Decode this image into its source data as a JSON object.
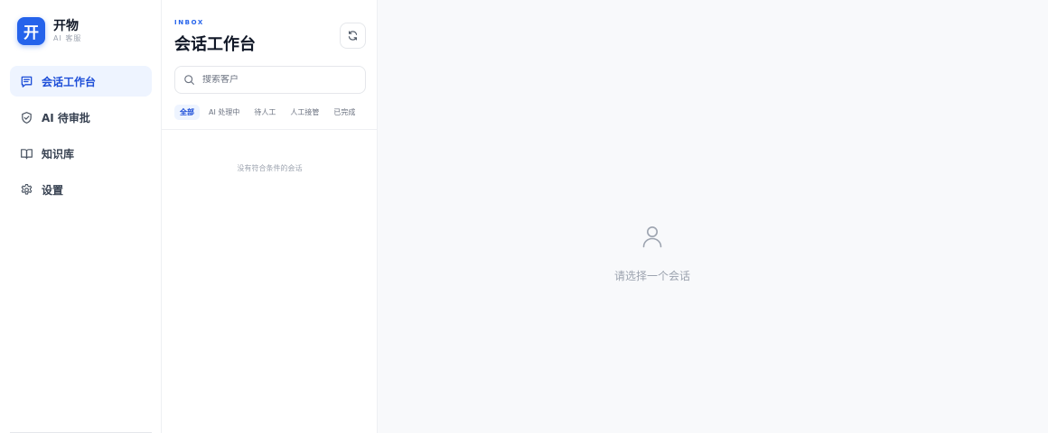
{
  "brand": {
    "logo_glyph": "开",
    "name": "开物",
    "subtitle": "AI 客服",
    "accent": "#2563eb"
  },
  "sidebar": {
    "items": [
      {
        "label": "会话工作台",
        "icon": "chat-lines-icon",
        "active": true
      },
      {
        "label": "AI 待审批",
        "icon": "shield-check-icon",
        "active": false
      },
      {
        "label": "知识库",
        "icon": "book-open-icon",
        "active": false
      },
      {
        "label": "设置",
        "icon": "gear-icon",
        "active": false
      }
    ]
  },
  "inbox": {
    "eyebrow": "INBOX",
    "title": "会话工作台",
    "refresh_icon": "refresh-icon",
    "search": {
      "placeholder": "搜索客户",
      "value": ""
    },
    "filters": [
      {
        "label": "全部",
        "active": true
      },
      {
        "label": "AI 处理中",
        "active": false
      },
      {
        "label": "待人工",
        "active": false
      },
      {
        "label": "人工接管",
        "active": false
      },
      {
        "label": "已完成",
        "active": false
      }
    ],
    "empty_text": "没有符合条件的会话"
  },
  "main": {
    "placeholder_icon": "user-icon",
    "placeholder_text": "请选择一个会话"
  }
}
